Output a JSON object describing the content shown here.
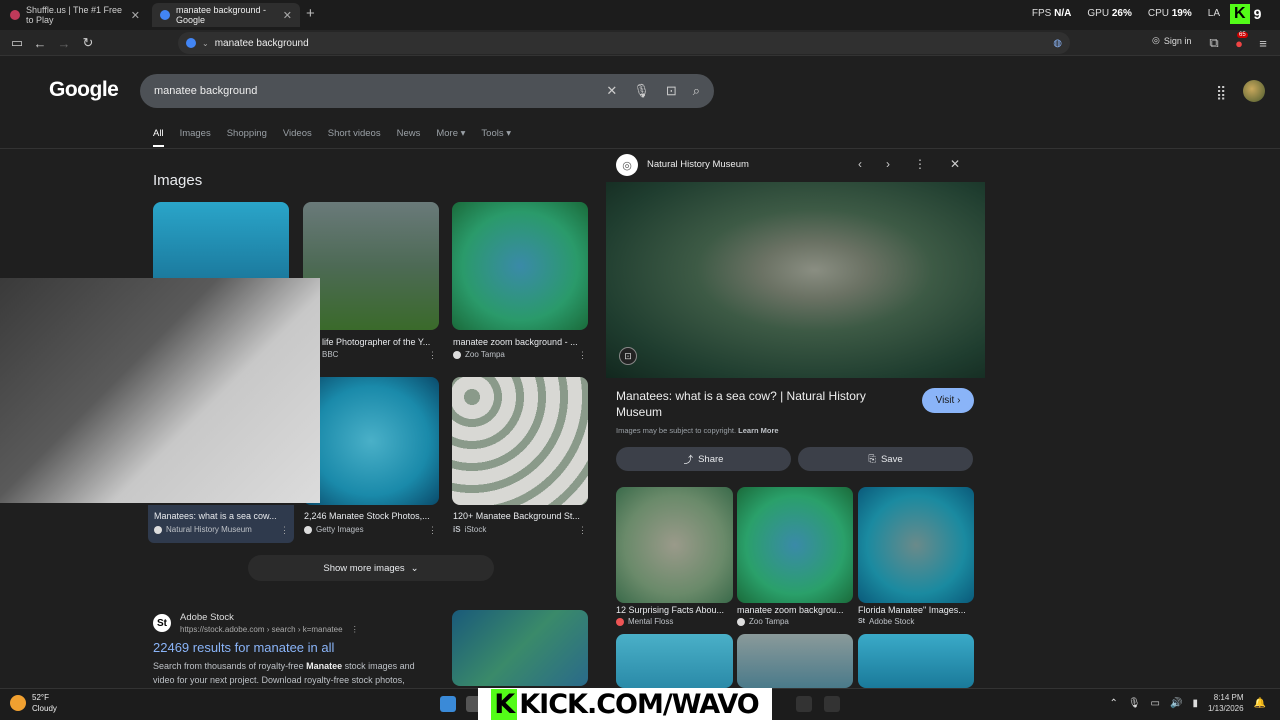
{
  "browser": {
    "tabs": [
      {
        "title": "Shuffle.us | The #1 Free to Play"
      },
      {
        "title": "manatee background - Google"
      }
    ],
    "url": "manatee background",
    "sign_in": "Sign in",
    "ext_badge": "65"
  },
  "overlay": {
    "fps_label": "FPS",
    "fps_value": "N/A",
    "gpu_label": "GPU",
    "gpu_value": "26%",
    "cpu_label": "CPU",
    "cpu_value": "19%",
    "la": "LA",
    "kick_count": "9",
    "kick_banner": "KICK.COM/WAVO"
  },
  "google": {
    "logo": "Google",
    "query": "manatee background",
    "tabs": [
      "All",
      "Images",
      "Shopping",
      "Videos",
      "Short videos",
      "News",
      "More",
      "Tools"
    ],
    "images_heading": "Images",
    "results": [
      {
        "caption": "",
        "source": ""
      },
      {
        "caption": "life Photographer of the Y...",
        "source": "BBC"
      },
      {
        "caption": "manatee zoom background - ...",
        "source": "Zoo Tampa"
      },
      {
        "caption": "Manatees: what is a sea cow...",
        "source": "Natural History Museum"
      },
      {
        "caption": "2,246 Manatee Stock Photos,...",
        "source": "Getty Images"
      },
      {
        "caption": "120+ Manatee Background St...",
        "source": "iStock"
      }
    ],
    "show_more": "Show more images",
    "adobe": {
      "name": "Adobe Stock",
      "url": "https://stock.adobe.com › search › k=manatee",
      "title": "22469 results for manatee in all",
      "desc_pre": "Search from thousands of royalty-free ",
      "desc_bold": "Manatee",
      "desc_post": " stock images and video for your next project. Download royalty-free stock photos,"
    }
  },
  "panel": {
    "source": "Natural History Museum",
    "title": "Manatees: what is a sea cow? | Natural History Museum",
    "visit": "Visit",
    "copyright": "Images may be subject to copyright.",
    "learn_more": "Learn More",
    "share": "Share",
    "save": "Save",
    "related": [
      {
        "caption": "12 Surprising Facts Abou...",
        "source": "Mental Floss"
      },
      {
        "caption": "manatee zoom backgrou...",
        "source": "Zoo Tampa"
      },
      {
        "caption": "Florida Manatee\" Images...",
        "source": "Adobe Stock"
      }
    ]
  },
  "taskbar": {
    "temp": "52°F",
    "condition": "Cloudy",
    "time": "8:14 PM",
    "date": "1/13/2026"
  }
}
